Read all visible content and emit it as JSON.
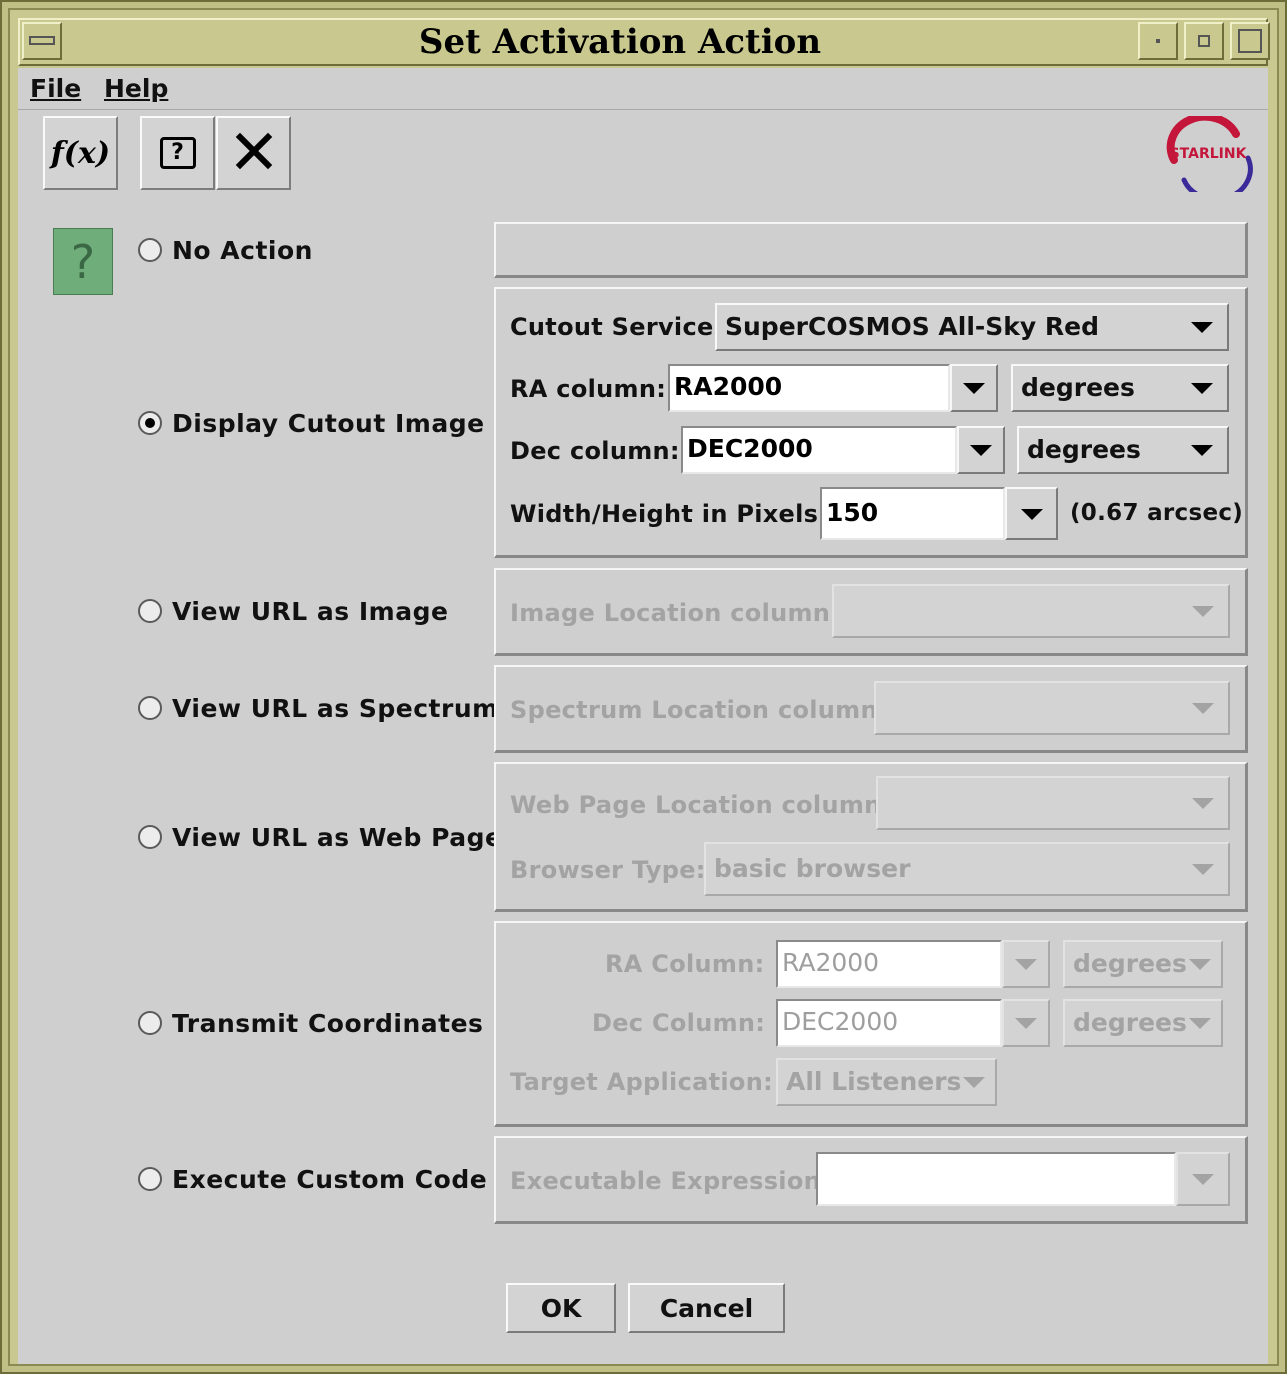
{
  "window": {
    "title": "Set Activation Action"
  },
  "menubar": {
    "file": "File",
    "help": "Help"
  },
  "toolbar": {
    "function_label": "f(x)",
    "help_glyph": "?",
    "close_glyph": "✕",
    "logo_text": "STARLINK"
  },
  "help_badge_glyph": "?",
  "options": [
    {
      "label": "No Action",
      "selected": false
    },
    {
      "label": "Display Cutout Image",
      "selected": true
    },
    {
      "label": "View URL as Image",
      "selected": false
    },
    {
      "label": "View URL as Spectrum",
      "selected": false
    },
    {
      "label": "View URL as Web Page",
      "selected": false
    },
    {
      "label": "Transmit Coordinates",
      "selected": false
    },
    {
      "label": "Execute Custom Code",
      "selected": false
    }
  ],
  "cutout": {
    "service_label": "Cutout Service:",
    "service_value": "SuperCOSMOS All-Sky Red",
    "ra_label": "RA column:",
    "ra_value": "RA2000",
    "ra_unit": "degrees",
    "dec_label": "Dec column:",
    "dec_value": "DEC2000",
    "dec_unit": "degrees",
    "size_label": "Width/Height in Pixels:",
    "size_value": "150",
    "size_note": "(0.67 arcsec)"
  },
  "url_image": {
    "label": "Image Location column:",
    "value": ""
  },
  "url_spectrum": {
    "label": "Spectrum Location column:",
    "value": ""
  },
  "url_web": {
    "label": "Web Page Location column:",
    "value": "",
    "browser_label": "Browser Type:",
    "browser_value": "basic browser"
  },
  "transmit": {
    "ra_label": "RA Column:",
    "ra_value": "RA2000",
    "ra_unit": "degrees",
    "dec_label": "Dec Column:",
    "dec_value": "DEC2000",
    "dec_unit": "degrees",
    "target_label": "Target Application:",
    "target_value": "All Listeners"
  },
  "custom": {
    "label": "Executable Expression:",
    "value": ""
  },
  "buttons": {
    "ok": "OK",
    "cancel": "Cancel"
  },
  "colors": {
    "title_bar": "#c9c98f",
    "background": "#cfcfcf",
    "logo_red": "#c4163a",
    "logo_blue": "#3a2a9a",
    "help_badge": "#6fae7a"
  }
}
